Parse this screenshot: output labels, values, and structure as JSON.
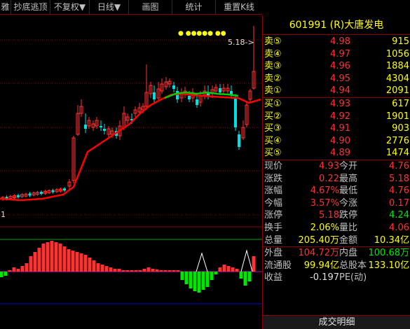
{
  "toolbar": {
    "items": [
      "雅",
      "抄底逃顶",
      "不复权▼",
      "日线▼",
      "画图",
      "统计",
      "重置K线"
    ]
  },
  "chart": {
    "price_label": "5.18->",
    "left_label": "1",
    "dot_markers": "●  ●●●●●   ●●"
  },
  "quote": {
    "title": "601991 (R)大唐发电",
    "asks": [
      {
        "label": "卖⑤",
        "price": "4.98",
        "vol": "915"
      },
      {
        "label": "卖④",
        "price": "4.97",
        "vol": "1056"
      },
      {
        "label": "卖③",
        "price": "4.96",
        "vol": "1884"
      },
      {
        "label": "卖②",
        "price": "4.95",
        "vol": "4304"
      },
      {
        "label": "卖①",
        "price": "4.94",
        "vol": "2091"
      }
    ],
    "bids": [
      {
        "label": "买①",
        "price": "4.93",
        "vol": "617"
      },
      {
        "label": "买②",
        "price": "4.92",
        "vol": "1901"
      },
      {
        "label": "买③",
        "price": "4.91",
        "vol": "903"
      },
      {
        "label": "买④",
        "price": "4.90",
        "vol": "2776"
      },
      {
        "label": "买⑤",
        "price": "4.89",
        "vol": "1474"
      }
    ],
    "stats": [
      {
        "l1": "现价",
        "v1": "4.93",
        "c1": "red",
        "l2": "今开",
        "v2": "4.76",
        "c2": "red"
      },
      {
        "l1": "涨跌",
        "v1": "0.22",
        "c1": "red",
        "l2": "最高",
        "v2": "5.18",
        "c2": "red"
      },
      {
        "l1": "涨幅",
        "v1": "4.67%",
        "c1": "red",
        "l2": "最低",
        "v2": "4.76",
        "c2": "red"
      },
      {
        "l1": "今幅",
        "v1": "3.57%",
        "c1": "red",
        "l2": "今涨",
        "v2": "0.17",
        "c2": "red"
      },
      {
        "l1": "涨停",
        "v1": "5.18",
        "c1": "red",
        "l2": "跌停",
        "v2": "4.24",
        "c2": "green"
      },
      {
        "l1": "换手",
        "v1": "2.06%",
        "c1": "yellow",
        "l2": "量比",
        "v2": "4.06",
        "c2": "red"
      },
      {
        "l1": "总量",
        "v1": "205.40万",
        "c1": "yellow",
        "l2": "金额",
        "v2": "10.34亿",
        "c2": "yellow"
      },
      {
        "l1": "外盘",
        "v1": "104.72万",
        "c1": "red",
        "l2": "内盘",
        "v2": "100.68万",
        "c2": "green"
      },
      {
        "l1": "流通股",
        "v1": "99.94亿",
        "c1": "yellow",
        "l2": "总股本",
        "v2": "133.10亿",
        "c2": "yellow"
      },
      {
        "l1": "收益",
        "v1": "-0.197",
        "c1": "white",
        "l2": "PE(动)",
        "v2": "",
        "c2": "white"
      }
    ],
    "detail_label": "成交明细"
  },
  "colors": {
    "up": "#ff3232",
    "down": "#00e0e0",
    "ma": "#ff0000",
    "ma_top": "#00cc00",
    "grid": "#8b0000",
    "bg": "#000000"
  }
}
